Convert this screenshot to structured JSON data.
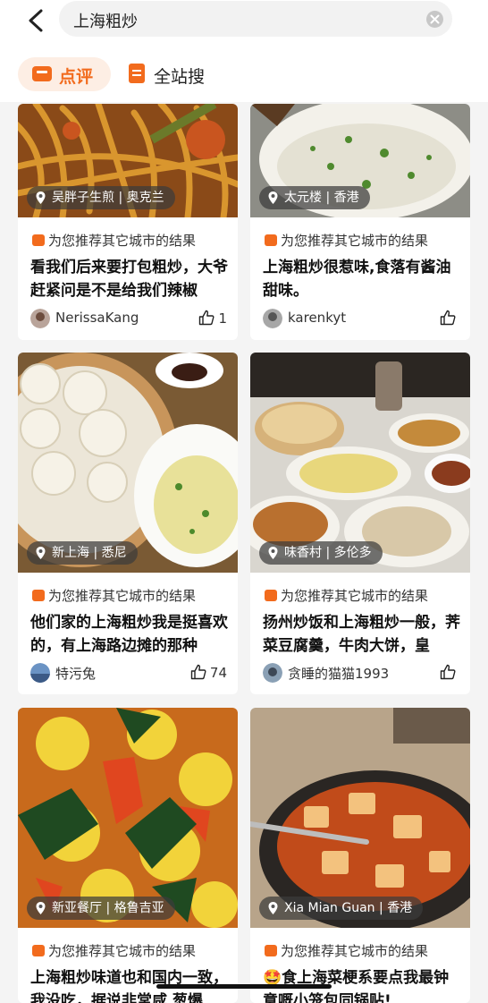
{
  "search": {
    "query": "上海粗炒"
  },
  "tabs": [
    {
      "label": "点评"
    },
    {
      "label": "全站搜"
    }
  ],
  "cards": [
    {
      "location": "吴胖子生煎",
      "city": "奥克兰",
      "rec": "为您推荐其它城市的结果",
      "title": "看我们后来要打包粗炒，大爷赶紧问是不是给我们辣椒",
      "user": "NerissaKang",
      "likes": "1"
    },
    {
      "location": "太元楼",
      "city": "香港",
      "rec": "为您推荐其它城市的结果",
      "title": "上海粗炒很惹味,食落有酱油甜味。",
      "user": "karenkyt",
      "likes": ""
    },
    {
      "location": "新上海",
      "city": "悉尼",
      "rec": "为您推荐其它城市的结果",
      "title": "他们家的上海粗炒我是挺喜欢的，有上海路边摊的那种",
      "user": "特污兔",
      "likes": "74"
    },
    {
      "location": "味香村",
      "city": "多伦多",
      "rec": "为您推荐其它城市的结果",
      "title": "扬州炒饭和上海粗炒一般，荠菜豆腐羹，牛肉大饼，皇",
      "user": "贪睡的猫猫1993",
      "likes": ""
    },
    {
      "location": "新亚餐厅",
      "city": "格鲁吉亚",
      "rec": "为您推荐其它城市的结果",
      "title": "上海粗炒味道也和国内一致，我没吃，据说非常咸 葱爆",
      "user": "",
      "likes": ""
    },
    {
      "location": "Xia Mian Guan",
      "city": "香港",
      "rec": "为您推荐其它城市的结果",
      "title": "🤩食上海菜梗系要点我最钟意嘅小笼包同锅贴!",
      "user": "",
      "likes": ""
    }
  ],
  "colors": {
    "accent": "#f26b1d",
    "tabBg": "#fdeee4"
  }
}
